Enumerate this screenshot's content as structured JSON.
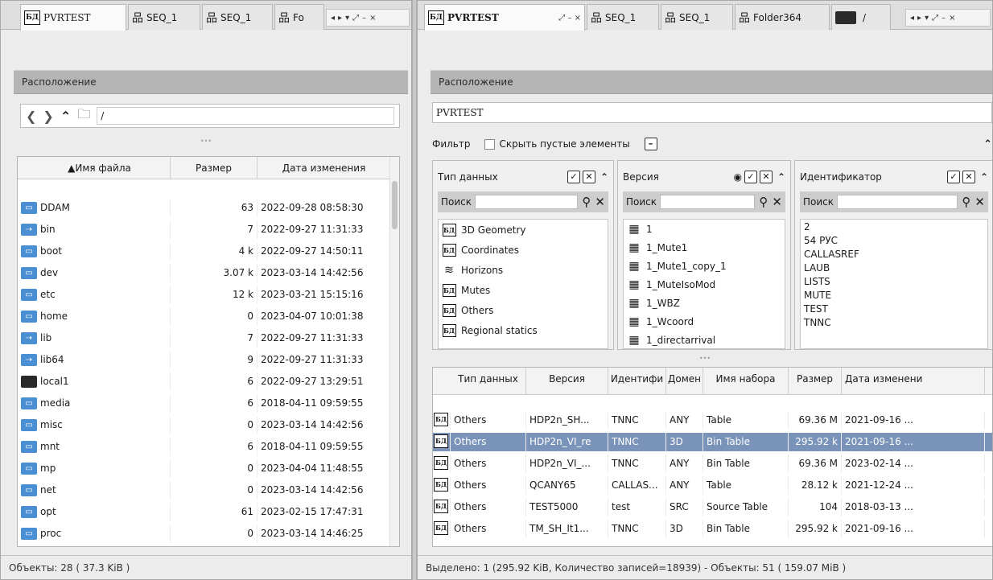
{
  "left": {
    "tabs": [
      {
        "label": "PVRTEST",
        "icon": "database-icon"
      },
      {
        "label": "SEQ_1",
        "icon": "sequence-icon"
      },
      {
        "label": "SEQ_1",
        "icon": "sequence-icon"
      },
      {
        "label": "Fo",
        "icon": "sequence-icon"
      }
    ],
    "tab_controls": [
      "◂",
      "▸",
      "▾",
      "⤢",
      "–",
      "×"
    ],
    "location_title": "Расположение",
    "path": "/",
    "divider_dots": "•••",
    "columns": [
      "▲Имя файла",
      "Размер",
      "Дата изменения"
    ],
    "rows": [
      {
        "icon": "folder-icon",
        "name": "DDAM",
        "size": "63",
        "date": "2022-09-28 08:58:30"
      },
      {
        "icon": "link-folder-icon",
        "name": "bin",
        "size": "7",
        "date": "2022-09-27 11:31:33"
      },
      {
        "icon": "folder-icon",
        "name": "boot",
        "size": "4 k",
        "date": "2022-09-27 14:50:11"
      },
      {
        "icon": "folder-icon",
        "name": "dev",
        "size": "3.07 k",
        "date": "2023-03-14 14:42:56"
      },
      {
        "icon": "folder-icon",
        "name": "etc",
        "size": "12 k",
        "date": "2023-03-21 15:15:16"
      },
      {
        "icon": "folder-icon",
        "name": "home",
        "size": "0",
        "date": "2023-04-07 10:01:38"
      },
      {
        "icon": "link-folder-icon",
        "name": "lib",
        "size": "7",
        "date": "2022-09-27 11:31:33"
      },
      {
        "icon": "link-folder-icon",
        "name": "lib64",
        "size": "9",
        "date": "2022-09-27 11:31:33"
      },
      {
        "icon": "dark-folder-icon",
        "name": "local1",
        "size": "6",
        "date": "2022-09-27 13:29:51"
      },
      {
        "icon": "folder-icon",
        "name": "media",
        "size": "6",
        "date": "2018-04-11 09:59:55"
      },
      {
        "icon": "folder-icon",
        "name": "misc",
        "size": "0",
        "date": "2023-03-14 14:42:56"
      },
      {
        "icon": "folder-icon",
        "name": "mnt",
        "size": "6",
        "date": "2018-04-11 09:59:55"
      },
      {
        "icon": "folder-icon",
        "name": "mp",
        "size": "0",
        "date": "2023-04-04 11:48:55"
      },
      {
        "icon": "folder-icon",
        "name": "net",
        "size": "0",
        "date": "2023-03-14 14:42:56"
      },
      {
        "icon": "folder-icon",
        "name": "opt",
        "size": "61",
        "date": "2023-02-15 17:47:31"
      },
      {
        "icon": "folder-icon",
        "name": "proc",
        "size": "0",
        "date": "2023-03-14 14:46:25"
      }
    ],
    "status": "Объекты: 28 ( 37.3 KiB )"
  },
  "right": {
    "tabs": [
      {
        "label": "PVRTEST",
        "icon": "database-icon"
      },
      {
        "label": "SEQ_1",
        "icon": "sequence-icon"
      },
      {
        "label": "SEQ_1",
        "icon": "sequence-icon"
      },
      {
        "label": "Folder364",
        "icon": "sequence-icon"
      },
      {
        "label": "/",
        "icon": "dark-folder-icon"
      }
    ],
    "tab_close": "⤢ – ×",
    "tab_controls": [
      "◂",
      "▸",
      "▾",
      "⤢",
      "–",
      "×"
    ],
    "location_title": "Расположение",
    "path": "PVRTEST",
    "filter_label": "Фильтр",
    "hide_empty_label": "Скрыть пустые элементы",
    "search_label": "Поиск",
    "divider_dots": "•••",
    "panels": {
      "datatype": {
        "title": "Тип данных",
        "items": [
          {
            "icon": "database-icon",
            "label": "3D Geometry"
          },
          {
            "icon": "database-icon",
            "label": "Coordinates"
          },
          {
            "icon": "horizons-icon",
            "label": "Horizons"
          },
          {
            "icon": "database-icon",
            "label": "Mutes"
          },
          {
            "icon": "database-icon",
            "label": "Others"
          },
          {
            "icon": "database-icon",
            "label": "Regional statics"
          }
        ]
      },
      "version": {
        "title": "Версия",
        "items": [
          {
            "icon": "table-icon",
            "label": "1"
          },
          {
            "icon": "table-icon",
            "label": "1_Mute1"
          },
          {
            "icon": "table-icon",
            "label": "1_Mute1_copy_1"
          },
          {
            "icon": "table-icon",
            "label": "1_MuteIsoMod"
          },
          {
            "icon": "table-icon",
            "label": "1_WBZ"
          },
          {
            "icon": "table-icon",
            "label": "1_Wcoord"
          },
          {
            "icon": "table-icon",
            "label": "1_directarrival"
          }
        ]
      },
      "identifier": {
        "title": "Идентификатор",
        "items": [
          "2",
          "54 РУС",
          "CALLASREF",
          "LAUB",
          "LISTS",
          "MUTE",
          "TEST",
          "TNNC"
        ]
      }
    },
    "columns": [
      "Тип данных",
      "Версия",
      "Идентифи",
      "Домен",
      "Имя набора",
      "Размер",
      "Дата изменени"
    ],
    "rows": [
      {
        "type": "Others",
        "version": "HDP2n_SH...",
        "id": "TNNC",
        "domain": "ANY",
        "set": "Table",
        "size": "69.36 M",
        "date": "2021-09-16 ...",
        "selected": false
      },
      {
        "type": "Others",
        "version": "HDP2n_VI_re",
        "id": "TNNC",
        "domain": "3D",
        "set": "Bin Table",
        "size": "295.92 k",
        "date": "2021-09-16 ...",
        "selected": true
      },
      {
        "type": "Others",
        "version": "HDP2n_VI_...",
        "id": "TNNC",
        "domain": "ANY",
        "set": "Bin Table",
        "size": "69.36 M",
        "date": "2023-02-14 ...",
        "selected": false
      },
      {
        "type": "Others",
        "version": "QCANY65",
        "id": "CALLAS...",
        "domain": "ANY",
        "set": "Table",
        "size": "28.12 k",
        "date": "2021-12-24 ...",
        "selected": false
      },
      {
        "type": "Others",
        "version": "TEST5000",
        "id": "test",
        "domain": "SRC",
        "set": "Source Table",
        "size": "104",
        "date": "2018-03-13 ...",
        "selected": false
      },
      {
        "type": "Others",
        "version": "TM_SH_It1...",
        "id": "TNNC",
        "domain": "3D",
        "set": "Bin Table",
        "size": "295.92 k",
        "date": "2021-09-16 ...",
        "selected": false
      }
    ],
    "status": "Выделено: 1 (295.92 KiB, Количество записей=18939)  -  Объекты: 51 ( 159.07 MiB )"
  },
  "colors": {
    "selection": "#7a93b8",
    "section_header": "#b5b5b5",
    "folder": "#4a8fd4"
  }
}
